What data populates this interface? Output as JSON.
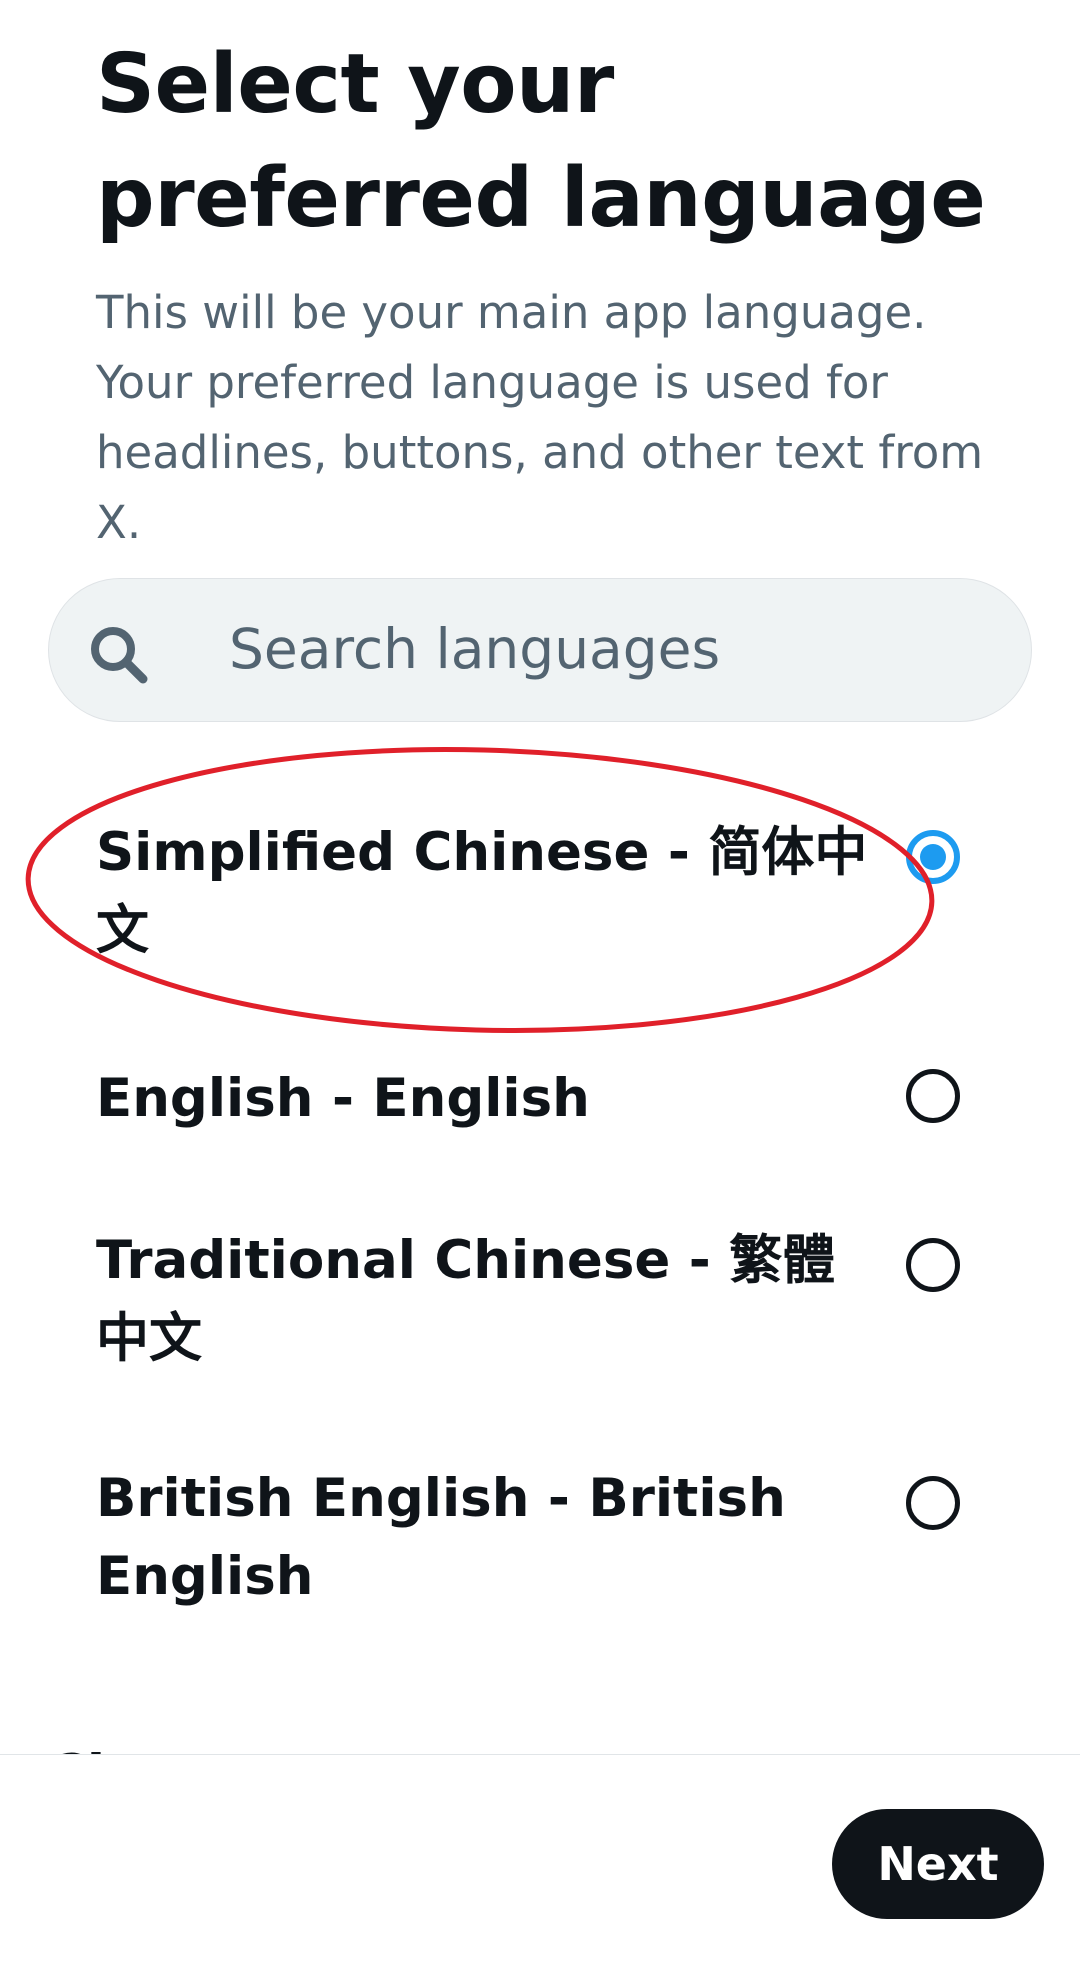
{
  "header": {
    "title": "Select your preferred language",
    "subtitle": "This will be your main app language. Your preferred language is used for headlines, buttons, and other text from X."
  },
  "search": {
    "placeholder": "Search languages",
    "value": "",
    "icon": "search-icon"
  },
  "languages": [
    {
      "label": "Simplified Chinese - 简体中文",
      "selected": true
    },
    {
      "label": "English - English",
      "selected": false
    },
    {
      "label": "Traditional Chinese - 繁體中文",
      "selected": false
    },
    {
      "label": "British English - British English",
      "selected": false
    }
  ],
  "next_item_peek": "Ch",
  "footer": {
    "next_label": "Next"
  },
  "colors": {
    "accent": "#1d9bf0",
    "text_primary": "#0f1419",
    "text_secondary": "#536471",
    "search_background": "#eff3f4",
    "annotation": "#e0202a"
  }
}
